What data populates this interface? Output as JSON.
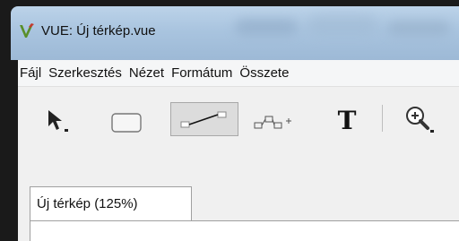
{
  "window": {
    "title": "VUE: Új térkép.vue",
    "app_icon": "vue-logo-icon",
    "accent": "#a9c4df"
  },
  "menu": {
    "items": [
      "Fájl",
      "Szerkesztés",
      "Nézet",
      "Formátum",
      "Összete"
    ]
  },
  "toolbar": {
    "tools": [
      {
        "name": "selection-arrow-icon",
        "has_dropdown": true
      },
      {
        "name": "rectangle-node-icon",
        "has_dropdown": false
      },
      {
        "name": "link-connector-icon",
        "pressed": true
      },
      {
        "name": "node-link-tool-icon",
        "has_dropdown": false
      },
      {
        "name": "text-tool-icon",
        "label": "T"
      },
      {
        "name": "zoom-in-icon",
        "has_dropdown": true
      }
    ]
  },
  "tabs": [
    {
      "label": "Új térkép (125%)",
      "active": true
    }
  ]
}
